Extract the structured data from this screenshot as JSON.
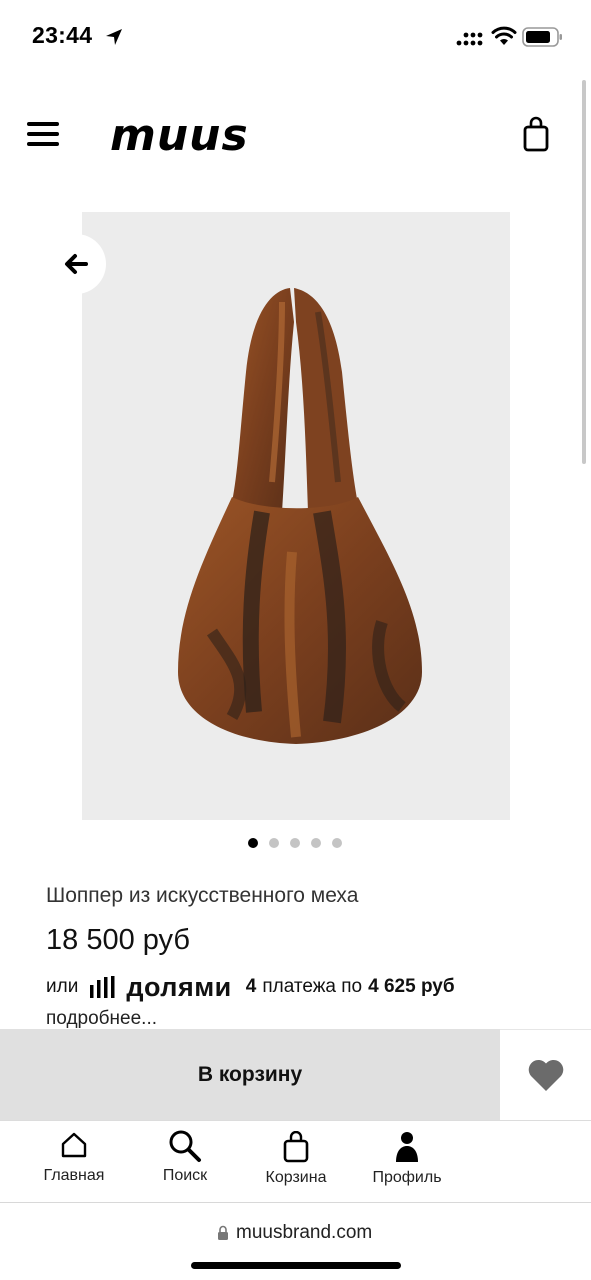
{
  "status_bar": {
    "time": "23:44"
  },
  "header": {
    "logo": "muus"
  },
  "product": {
    "name": "Шоппер из искусственного меха",
    "price": "18 500 руб",
    "image_count": 5,
    "active_image": 1
  },
  "installment": {
    "prefix": "или",
    "brand": "долями",
    "count": "4",
    "middle": "платежа по",
    "amount": "4 625 руб",
    "more": "подробнее..."
  },
  "actions": {
    "cart_label": "В корзину"
  },
  "nav": {
    "items": [
      {
        "label": "Главная",
        "icon": "home-icon"
      },
      {
        "label": "Поиск",
        "icon": "search-icon"
      },
      {
        "label": "Корзина",
        "icon": "bag-icon"
      },
      {
        "label": "Профиль",
        "icon": "profile-icon"
      }
    ]
  },
  "browser": {
    "url": "muusbrand.com"
  },
  "colors": {
    "cart_button_bg": "#e0e0e0",
    "image_bg": "#ececec",
    "heart": "#6b6b6b",
    "fur_brown": "#8a4a24",
    "fur_dark": "#3a2a20"
  }
}
